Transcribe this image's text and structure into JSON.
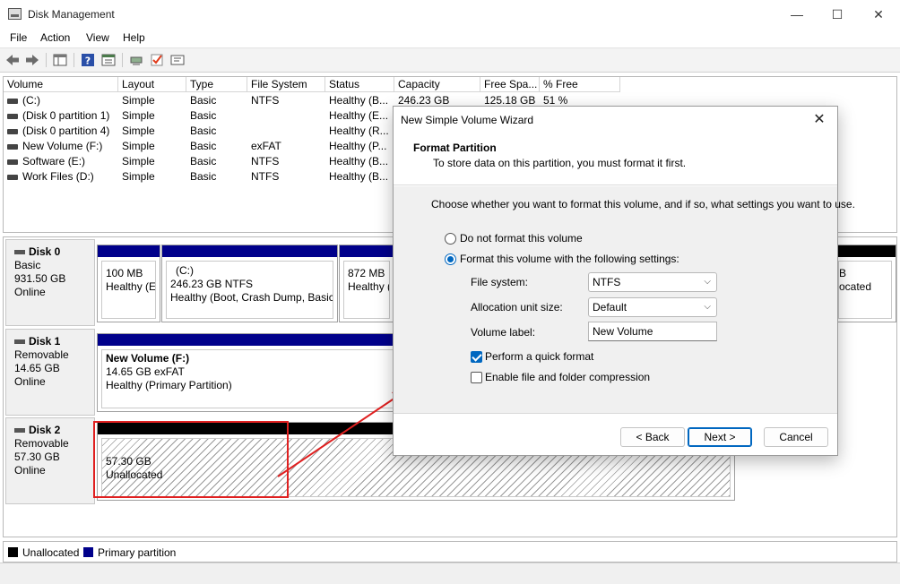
{
  "window": {
    "title": "Disk Management",
    "minimize": "—",
    "maximize": "☐",
    "close": "✕"
  },
  "menu": [
    "File",
    "Action",
    "View",
    "Help"
  ],
  "toolbar": [
    "back-arrow-icon",
    "forward-arrow-icon",
    "console-tree-icon",
    "help-icon",
    "refresh-icon",
    "connect-icon",
    "check-icon",
    "properties-icon"
  ],
  "volume_list": {
    "columns": [
      "Volume",
      "Layout",
      "Type",
      "File System",
      "Status",
      "Capacity",
      "Free Spa...",
      "% Free"
    ],
    "rows": [
      [
        "(C:)",
        "Simple",
        "Basic",
        "NTFS",
        "Healthy (B...",
        "246.23 GB",
        "125.18 GB",
        "51 %"
      ],
      [
        "(Disk 0 partition 1)",
        "Simple",
        "Basic",
        "",
        "Healthy (E...",
        "",
        "",
        ""
      ],
      [
        "(Disk 0 partition 4)",
        "Simple",
        "Basic",
        "",
        "Healthy (R...",
        "",
        "",
        ""
      ],
      [
        "New Volume (F:)",
        "Simple",
        "Basic",
        "exFAT",
        "Healthy (P...",
        "",
        "",
        ""
      ],
      [
        "Software (E:)",
        "Simple",
        "Basic",
        "NTFS",
        "Healthy (B...",
        "",
        "",
        ""
      ],
      [
        "Work Files (D:)",
        "Simple",
        "Basic",
        "NTFS",
        "Healthy (B...",
        "",
        "",
        ""
      ]
    ]
  },
  "disks": [
    {
      "name": "Disk 0",
      "type": "Basic",
      "size": "931.50 GB",
      "state": "Online"
    },
    {
      "name": "Disk 1",
      "type": "Removable",
      "size": "14.65 GB",
      "state": "Online"
    },
    {
      "name": "Disk 2",
      "type": "Removable",
      "size": "57.30 GB",
      "state": "Online"
    }
  ],
  "partitions": {
    "d0p1": {
      "line1": "100 MB",
      "line2": "Healthy (EF"
    },
    "d0p2": {
      "line1": "(C:)",
      "line2": "246.23 GB NTFS",
      "line3": "Healthy (Boot, Crash Dump, Basic"
    },
    "d0p3": {
      "line1": "872 MB",
      "line2": "Healthy (R"
    },
    "d0p4": {
      "line2": "B",
      "line3": "ocated"
    },
    "d1p1": {
      "line1": "New Volume  (F:)",
      "line2": "14.65 GB exFAT",
      "line3": "Healthy (Primary Partition)"
    },
    "d2p1": {
      "line1": "57.30 GB",
      "line2": "Unallocated"
    }
  },
  "legend": [
    {
      "label": "Unallocated",
      "color": "#000000"
    },
    {
      "label": "Primary partition",
      "color": "#00008b"
    }
  ],
  "dialog": {
    "title": "New Simple Volume Wizard",
    "close": "✕",
    "header_title": "Format Partition",
    "header_subtitle": "To store data on this partition, you must format it first.",
    "intro": "Choose whether you want to format this volume, and if so, what settings you want to use.",
    "radio_no_format": "Do not format this volume",
    "radio_format": "Format this volume with the following settings:",
    "file_system_label": "File system:",
    "file_system_value": "NTFS",
    "alloc_label": "Allocation unit size:",
    "alloc_value": "Default",
    "volume_label_label": "Volume label:",
    "volume_label_value": "New Volume",
    "quick_format": "Perform a quick format",
    "compression": "Enable file and folder compression",
    "back": "< Back",
    "next": "Next >",
    "cancel": "Cancel"
  },
  "colors": {
    "accent": "#0067c0",
    "primary_partition": "#00008b",
    "annotation": "#e02020"
  }
}
